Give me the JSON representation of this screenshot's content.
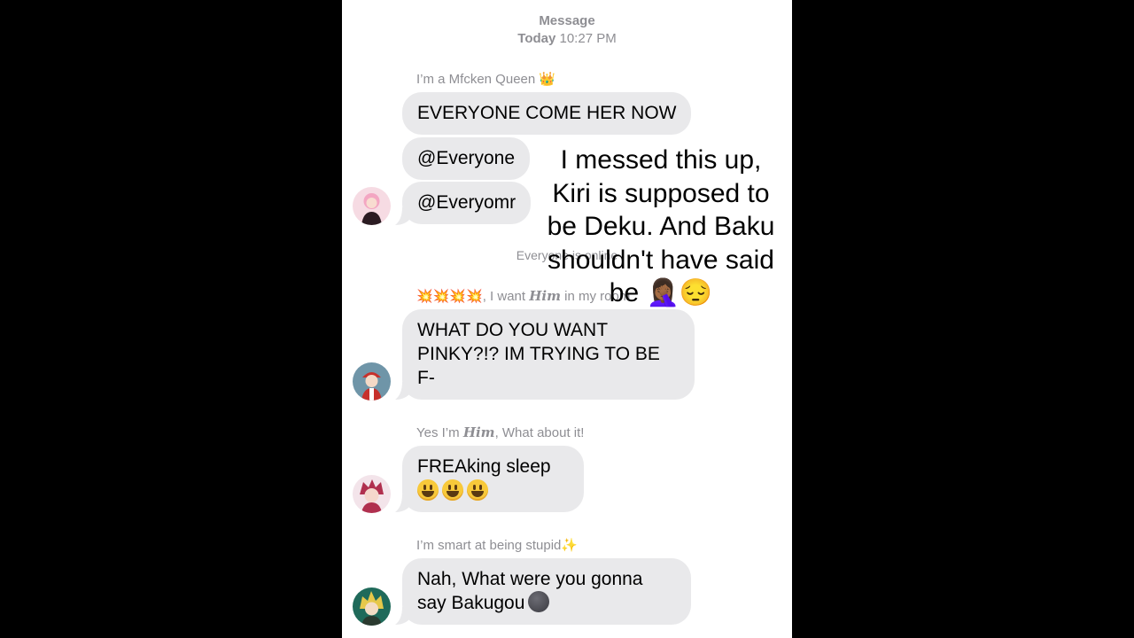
{
  "header": {
    "app_label": "Message",
    "day_label": "Today",
    "time_label": "10:27 PM"
  },
  "messages": [
    {
      "sender": "I’m a Mfcken Queen 👑",
      "bubbles": [
        "EVERYONE COME HER NOW",
        "@Everyone",
        "@Everyomr"
      ],
      "avatar": "pink-haired-avatar"
    },
    {
      "status": "Everyone is online",
      "sender_prefix": "💥💥💥💥, I want ",
      "sender_em": "Him",
      "sender_suffix": " in my room",
      "bubble_lines": [
        "WHAT DO YOU WANT",
        "PINKY?!? IM TRYING TO BE",
        "F-"
      ],
      "avatar": "red-cap-avatar"
    },
    {
      "sender_prefix": "Yes I’m ",
      "sender_em": "Him",
      "sender_suffix": ", What about it!",
      "bubble_lines": [
        "FREAking sleep"
      ],
      "avatar": "red-haired-avatar"
    },
    {
      "sender": "I’m smart at being stupid✨",
      "bubble_lines": [
        "Nah, What were you gonna",
        "say Bakugou"
      ],
      "avatar": "blonde-avatar"
    }
  ],
  "overlay_text": {
    "lines": [
      "I messed this up,",
      "Kiri is supposed to",
      "be Deku. And Baku",
      "shouldn't have said",
      "be 🤦🏾‍♀️😔"
    ]
  },
  "colors": {
    "background": "#000000",
    "screen": "#ffffff",
    "bubble": "#e9e9eb",
    "meta_text": "#8e8e93"
  }
}
